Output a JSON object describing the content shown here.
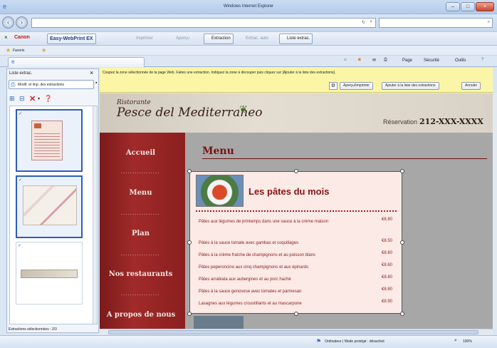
{
  "window": {
    "title": "Windows Internet Explorer"
  },
  "address_bar": {
    "url": "",
    "search_placeholder": ""
  },
  "plugin_bar": {
    "close": "×",
    "brand": "Canon",
    "product": "Easy-WebPrint EX",
    "print": "Imprimer",
    "preview": "Aperçu",
    "extract": "Extraction",
    "extract_auto": "Extrac. auto",
    "clip_list": "Liste extrac."
  },
  "favorites_bar": {
    "favorites": "Favoris"
  },
  "command_bar": {
    "page": "Page",
    "safety": "Sécurité",
    "tools": "Outils"
  },
  "left_pane": {
    "title": "Liste extrac.",
    "close": "×",
    "tab_label": "Modif. et imp. des extractions",
    "status": "Extractions sélectionnées : 2/3"
  },
  "info_bar": {
    "message": "Coupez la zone sélectionnée de la page Web. Faites une extraction. Indiquez la zone à découper puis cliquez sur [Ajouter à la liste des extractions].",
    "buttons": {
      "preview_print": "Aperçu/Imprimer",
      "add_to_list": "Ajouter à la liste des extractions",
      "cancel": "Annuler"
    }
  },
  "webpage": {
    "brand_line1": "Ristorante",
    "brand_line2": "Pesce del Mediterraneo",
    "reservation_label": "Réservation",
    "reservation_phone": "212-XXX-XXXX",
    "nav": [
      "Accueil",
      "Menu",
      "Plan",
      "Nos restaurants",
      "A propos de nous"
    ],
    "nav_dots": ".................",
    "menu_title": "Menu",
    "box_title": "Les pâtes du mois",
    "items": [
      {
        "name": "Pâtes aux légumes de printemps dans une sauce à la crème maison",
        "price": "€8.80"
      },
      {
        "name": "Pâtes à la sauce tomate avec gambas et coquillages",
        "price": "€8.50"
      },
      {
        "name": "Pâtes à la crème fraîche de champignons et au poisson blanc",
        "price": "€8.60"
      },
      {
        "name": "Pâtes peperoncino aux cinq champignons et aux épinards",
        "price": "€8.60"
      },
      {
        "name": "Pâtes arrabiata aux aubergines et au porc haché",
        "price": "€8.80"
      },
      {
        "name": "Pâtes à la sauce genovese avec tomates et parmesan",
        "price": "€8.80"
      },
      {
        "name": "Lasagnes aux légumes croustillants et au mascarpone",
        "price": "€8.90"
      }
    ]
  },
  "status_bar": {
    "zone": "Ordinateur | Mode protégé : désactivé",
    "zoom": "100%"
  },
  "colors": {
    "accent": "#2d5db5",
    "nav_red": "#8b1f1f",
    "menu_red": "#8a1212",
    "info_yellow": "#fbf6a6"
  }
}
